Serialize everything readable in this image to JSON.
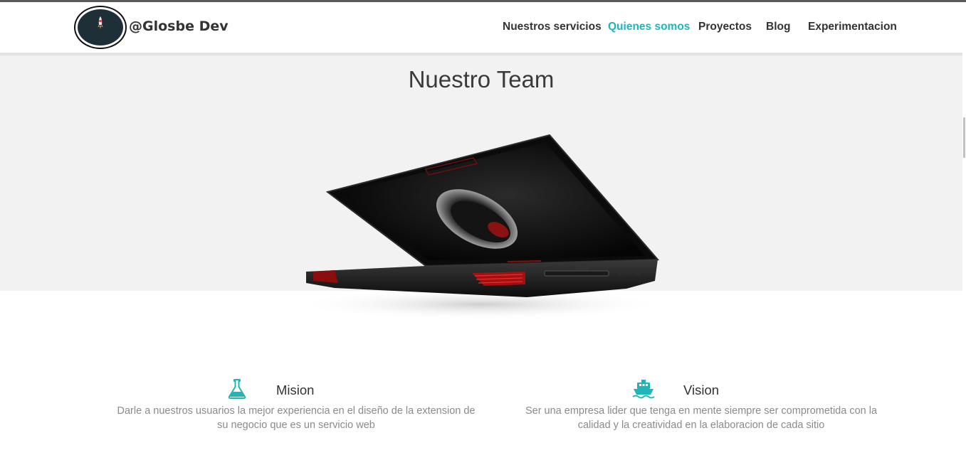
{
  "brand": {
    "name": "@Glosbe Dev",
    "logo_icon": "rocket-icon"
  },
  "nav": {
    "items": [
      {
        "label": "Nuestros servicios",
        "active": false
      },
      {
        "label": "Quienes somos",
        "active": true
      },
      {
        "label": "Proyectos",
        "active": false
      },
      {
        "label": "Blog",
        "active": false
      },
      {
        "label": "Experimentacion",
        "active": false
      }
    ],
    "active_color": "#1fb5b9"
  },
  "hero": {
    "title": "Nuestro Team",
    "image": "laptop-image"
  },
  "features": {
    "mision": {
      "icon": "flask-icon",
      "title": "Mision",
      "text": "Darle a nuestros usuarios la mejor experiencia en el diseño de la extension de su negocio que es un servicio web"
    },
    "vision": {
      "icon": "ship-icon",
      "title": "Vision",
      "text": "Ser una empresa lider que tenga en mente siempre ser comprometida con la calidad y la creatividad en la elaboracion de cada sitio"
    }
  },
  "colors": {
    "accent": "#1fb5b9",
    "hero_bg": "#f2f2f2",
    "text_dark": "#333333",
    "text_muted": "#8a8a8a"
  }
}
